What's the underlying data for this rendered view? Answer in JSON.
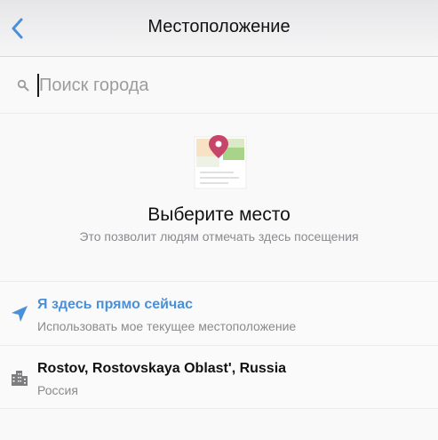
{
  "navbar": {
    "title": "Местоположение",
    "back_icon": "chevron-left-icon",
    "accent_color": "#4a90d9"
  },
  "search": {
    "placeholder": "Поиск города",
    "value": "",
    "icon": "search-icon"
  },
  "empty_state": {
    "icon": "map-pin-illustration",
    "title": "Выберите место",
    "subtitle": "Это позволит людям отмечать здесь посещения"
  },
  "list": {
    "items": [
      {
        "icon": "location-arrow-icon",
        "title": "Я здесь прямо сейчас",
        "subtitle": "Использовать мое текущее местоположение",
        "title_color": "#4a90d9"
      },
      {
        "icon": "city-buildings-icon",
        "title": "Rostov, Rostovskaya Oblast', Russia",
        "subtitle": "Россия"
      }
    ]
  }
}
